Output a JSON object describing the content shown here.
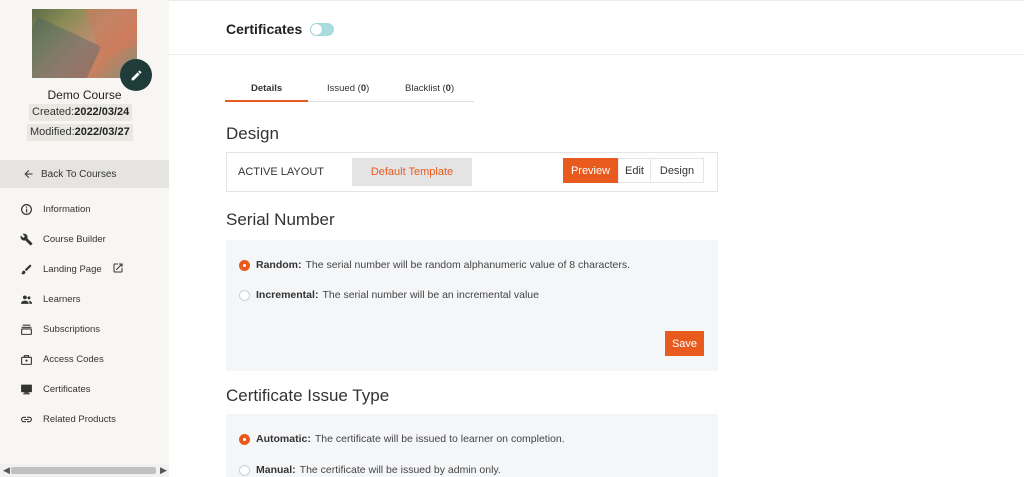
{
  "sidebar": {
    "course_name": "Demo Course",
    "created_label": "Created:",
    "created_value": "2022/03/24",
    "modified_label": "Modified:",
    "modified_value": "2022/03/27",
    "back_label": "Back To Courses",
    "items": [
      {
        "label": "Information",
        "icon": "info-icon"
      },
      {
        "label": "Course Builder",
        "icon": "wrench-icon"
      },
      {
        "label": "Landing Page",
        "icon": "brush-icon"
      },
      {
        "label": "Learners",
        "icon": "people-icon"
      },
      {
        "label": "Subscriptions",
        "icon": "subscriptions-icon"
      },
      {
        "label": "Access Codes",
        "icon": "access-codes-icon"
      },
      {
        "label": "Certificates",
        "icon": "certificate-icon"
      },
      {
        "label": "Related Products",
        "icon": "link-icon"
      }
    ]
  },
  "header": {
    "title": "Certificates"
  },
  "tabs": [
    {
      "label": "Details",
      "active": true
    },
    {
      "label": "Issued",
      "count": "0"
    },
    {
      "label": "Blacklist",
      "count": "0"
    }
  ],
  "design": {
    "title": "Design",
    "active_layout_label": "ACTIVE LAYOUT",
    "template_label": "Default Template",
    "preview_label": "Preview",
    "edit_label": "Edit",
    "design_label": "Design"
  },
  "serial": {
    "title": "Serial Number",
    "options": [
      {
        "label": "Random:",
        "desc": "The serial number will be random alphanumeric value of 8 characters.",
        "checked": true
      },
      {
        "label": "Incremental:",
        "desc": "The serial number will be an incremental value",
        "checked": false
      }
    ],
    "save_label": "Save"
  },
  "issue_type": {
    "title": "Certificate Issue Type",
    "options": [
      {
        "label": "Automatic:",
        "desc": "The certificate will be issued to learner on completion.",
        "checked": true
      },
      {
        "label": "Manual:",
        "desc": "The certificate will be issued by admin only.",
        "checked": false
      }
    ]
  },
  "colors": {
    "accent": "#e85a1e",
    "sidebar_bg": "#f8f6f2",
    "fab_bg": "#1f3b3a",
    "toggle_bg": "#a9dcdf"
  }
}
